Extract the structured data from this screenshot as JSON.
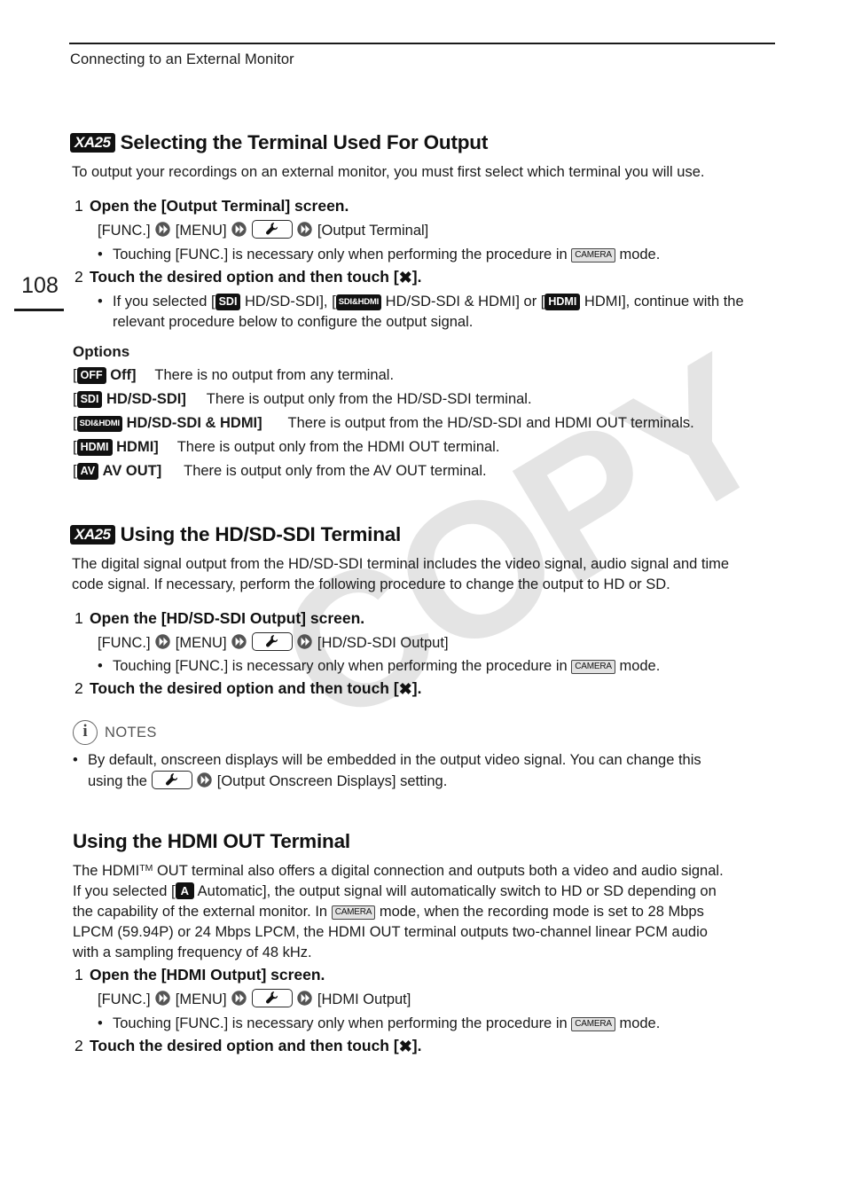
{
  "page": {
    "running_head": "Connecting to an External Monitor",
    "page_number": "108"
  },
  "section1": {
    "badge": "XA25",
    "title": "Selecting the Terminal Used For Output",
    "intro": "To output your recordings on an external monitor, you must first select which terminal you will use.",
    "step1": {
      "num": "1",
      "text": "Open the [Output Terminal] screen.",
      "path_start": "[FUNC.]",
      "path_menu": "[MENU]",
      "path_end": "[Output Terminal]",
      "bullet_pre": "Touching [FUNC.] is necessary only when performing the procedure in",
      "bullet_mode": "CAMERA",
      "bullet_post": "mode."
    },
    "step2": {
      "num": "2",
      "text_pre": "Touch the desired option and then touch [",
      "text_post": "].",
      "bullet_l1_a": "If you selected [",
      "bullet_badge1": "SDI",
      "bullet_l1_b": "HD/SD-SDI], [",
      "bullet_badge2": "SDI&HDMI",
      "bullet_l1_c": "HD/SD-SDI & HDMI] or [",
      "bullet_badge3": "HDMI",
      "bullet_l1_d": "HDMI], continue with the",
      "bullet_l2": "relevant procedure below to configure the output signal."
    },
    "options_label": "Options",
    "options": [
      {
        "badge": "OFF",
        "name": "Off]",
        "desc": "There is no output from any terminal."
      },
      {
        "badge": "SDI",
        "name": "HD/SD-SDI]",
        "desc": "There is output only from the HD/SD-SDI terminal."
      },
      {
        "badge": "SDI&HDMI",
        "name": "HD/SD-SDI & HDMI]",
        "desc": "There is output from the HD/SD-SDI and HDMI OUT terminals."
      },
      {
        "badge": "HDMI",
        "name": "HDMI]",
        "desc": "There is output only from the HDMI OUT terminal."
      },
      {
        "badge": "AV",
        "name": "AV OUT]",
        "desc": "There is output only from the AV OUT terminal."
      }
    ]
  },
  "section2": {
    "badge": "XA25",
    "title": "Using the HD/SD-SDI Terminal",
    "intro_l1": "The digital signal output from the HD/SD-SDI terminal includes the video signal, audio signal and time",
    "intro_l2": "code signal. If necessary, perform the following procedure to change the output to HD or SD.",
    "step1": {
      "num": "1",
      "text": "Open the [HD/SD-SDI Output] screen.",
      "path_start": "[FUNC.]",
      "path_menu": "[MENU]",
      "path_end": "[HD/SD-SDI Output]",
      "bullet_pre": "Touching [FUNC.] is necessary only when performing the procedure in",
      "bullet_mode": "CAMERA",
      "bullet_post": "mode."
    },
    "step2": {
      "num": "2",
      "text_pre": "Touch the desired option and then touch [",
      "text_post": "]."
    }
  },
  "notes": {
    "label": "NOTES",
    "items_l1": "By default, onscreen displays will be embedded in the output video signal. You can change this",
    "items_l2_pre": "using the",
    "items_l2_post": "[Output Onscreen Displays] setting."
  },
  "section3": {
    "title": "Using the HDMI OUT Terminal",
    "intro_l1_a": "The HDMI",
    "intro_l1_tm": "TM",
    "intro_l1_b": " OUT terminal also offers a digital connection and outputs both a video and audio signal.",
    "intro_l2_a": "If you selected [",
    "intro_l2_badge": "A",
    "intro_l2_b": "Automatic], the output signal will automatically switch to HD or SD depending on",
    "intro_l3_a": "the capability of the external monitor. In",
    "intro_l3_mode": "CAMERA",
    "intro_l3_b": "mode, when the recording mode is set to 28 Mbps",
    "intro_l4": "LPCM (59.94P) or 24 Mbps LPCM, the HDMI OUT terminal outputs two-channel linear PCM audio",
    "intro_l5": "with a sampling frequency of 48 kHz.",
    "step1": {
      "num": "1",
      "text": "Open the [HDMI Output] screen.",
      "path_start": "[FUNC.]",
      "path_menu": "[MENU]",
      "path_end": "[HDMI Output]",
      "bullet_pre": "Touching [FUNC.] is necessary only when performing the procedure in",
      "bullet_mode": "CAMERA",
      "bullet_post": "mode."
    },
    "step2": {
      "num": "2",
      "text_pre": "Touch the desired option and then touch [",
      "text_post": "]."
    }
  },
  "watermark": {
    "text": "COPY"
  }
}
